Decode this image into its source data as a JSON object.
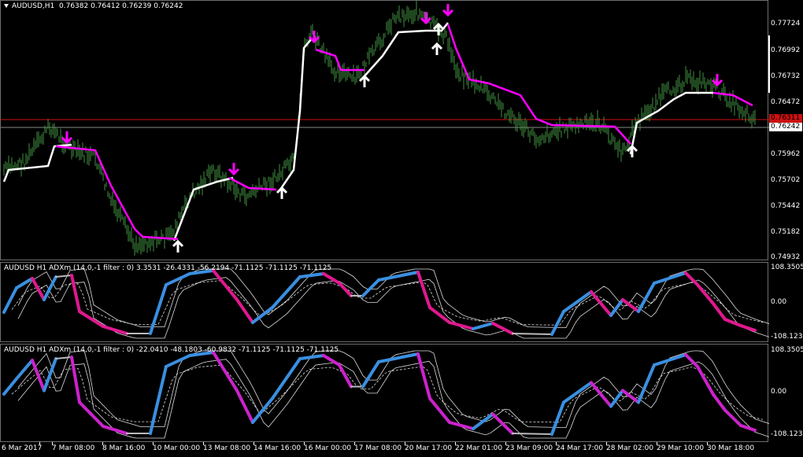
{
  "main_chart": {
    "symbol_label": "AUDUSD,H1",
    "ohlc": "0.76382 0.76412 0.76239 0.76242",
    "price_ticks": [
      "0.77724",
      "0.76992",
      "0.76732",
      "0.76472",
      "0.75962",
      "0.75702",
      "0.75442",
      "0.75182",
      "0.74932"
    ],
    "current_price": "0.76242",
    "red_line_price": "0.76311",
    "colors": {
      "bars": "#3f8f3f",
      "trend_up": "#ffffff",
      "trend_down": "#ff00ff",
      "red_line": "#cc1111",
      "bid_line": "#8a8a8a"
    }
  },
  "indicator_1": {
    "title": "AUDUSD H1 ADXm (14,0,-1 filter : 0) 3.3531 -26.4331 -56.2194 -71.1125 -71.1125 -71.1125",
    "ticks": [
      "108.3505",
      "0.00",
      "-108.1237"
    ],
    "colors": {
      "up": "#3a8fe0",
      "down": "#e0188f",
      "neutral": "#bbbbbb"
    }
  },
  "indicator_2": {
    "title": "AUDUSD H1 ADXm (14,0,-1 filter : 0) -22.0410 -48.1803 -60.9832 -71.1125 -71.1125 -71.1125",
    "ticks": [
      "108.3505",
      "0.00",
      "-108.1237"
    ],
    "colors": {
      "up": "#3a8fe0",
      "down": "#cc22cc",
      "neutral": "#bbbbbb"
    }
  },
  "time_axis": [
    "6 Mar 2017",
    "7 Mar 08:00",
    "8 Mar 16:00",
    "10 Mar 00:00",
    "13 Mar 08:00",
    "14 Mar 16:00",
    "16 Mar 00:00",
    "17 Mar 08:00",
    "20 Mar 17:00",
    "22 Mar 01:00",
    "23 Mar 09:00",
    "24 Mar 17:00",
    "28 Mar 02:00",
    "29 Mar 10:00",
    "30 Mar 18:00"
  ]
}
